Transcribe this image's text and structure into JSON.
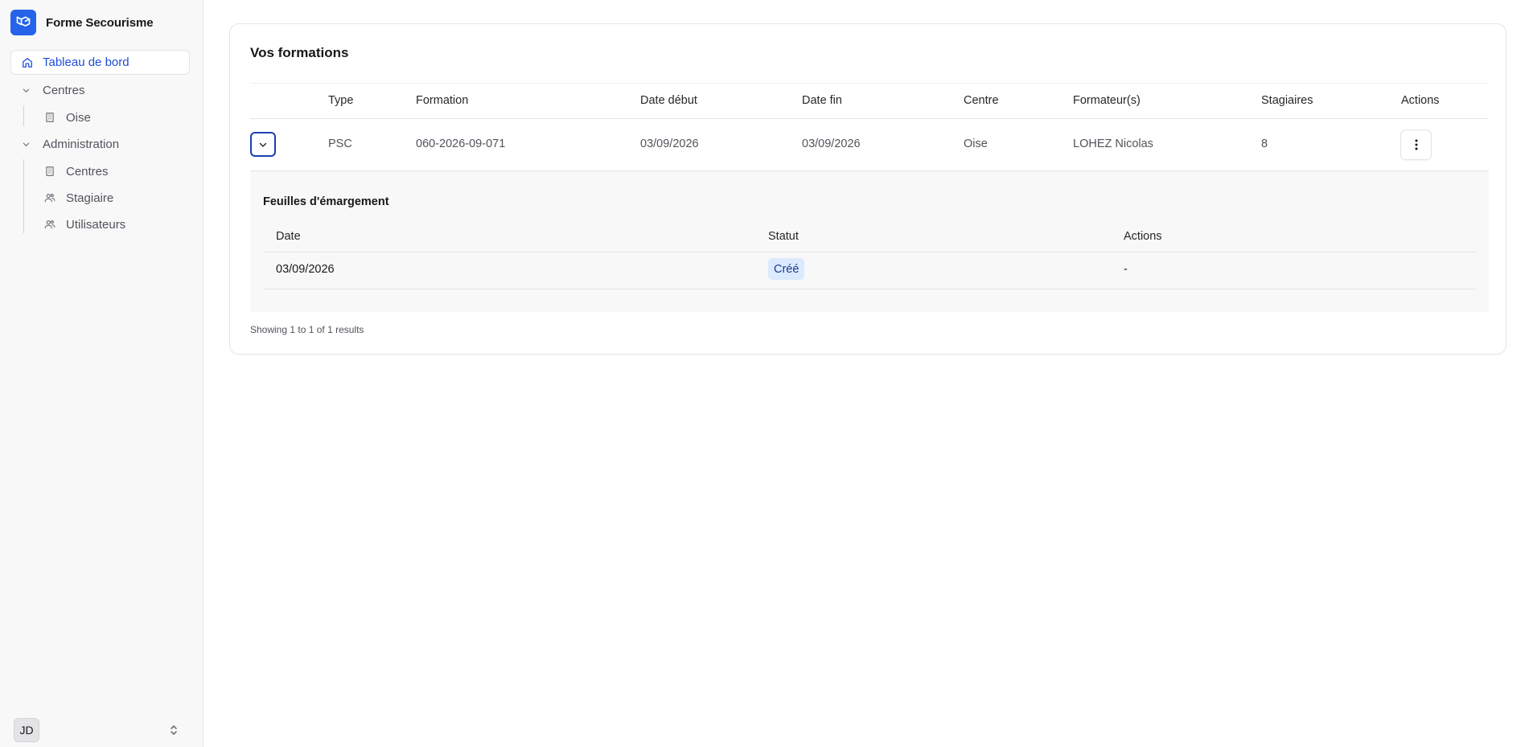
{
  "app": {
    "name": "Forme Secourisme"
  },
  "sidebar": {
    "active_item": "Tableau de bord",
    "groups": [
      {
        "label": "Centres",
        "items": [
          {
            "label": "Oise"
          }
        ]
      },
      {
        "label": "Administration",
        "items": [
          {
            "label": "Centres"
          },
          {
            "label": "Stagiaire"
          },
          {
            "label": "Utilisateurs"
          }
        ]
      }
    ],
    "user_initials": "JD"
  },
  "main": {
    "title": "Vos formations",
    "table": {
      "columns": [
        "Type",
        "Formation",
        "Date début",
        "Date fin",
        "Centre",
        "Formateur(s)",
        "Stagiaires",
        "Actions"
      ],
      "rows": [
        {
          "type": "PSC",
          "formation": "060-2026-09-071",
          "date_debut": "03/09/2026",
          "date_fin": "03/09/2026",
          "centre": "Oise",
          "formateurs": "LOHEZ Nicolas",
          "stagiaires": "8"
        }
      ]
    },
    "sub_panel": {
      "title": "Feuilles d'émargement",
      "columns": [
        "Date",
        "Statut",
        "Actions"
      ],
      "rows": [
        {
          "date": "03/09/2026",
          "statut": "Créé",
          "actions": "-"
        }
      ]
    },
    "pagination": "Showing 1 to 1 of 1 results"
  },
  "colors": {
    "accent": "#2563eb",
    "badge_bg": "#dbeafe"
  }
}
